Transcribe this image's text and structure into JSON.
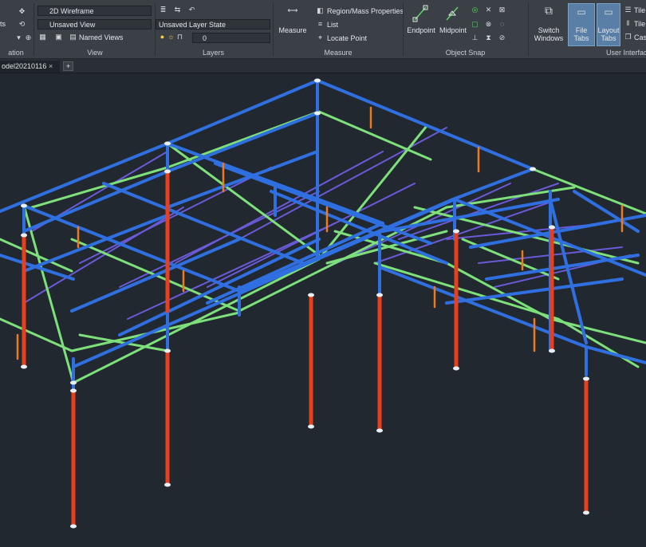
{
  "ribbon": {
    "panels": {
      "navigation_label": "ation",
      "view_label": "View",
      "layers_label": "Layers",
      "measure_label": "Measure",
      "object_snap_label": "Object Snap",
      "user_interface_label": "User Interfac"
    },
    "left_fragment": {
      "ts": "ts"
    },
    "view": {
      "visual_style": "2D Wireframe",
      "saved_view": "Unsaved View",
      "named_views": "Named Views"
    },
    "layers": {
      "layer_state": "Unsaved Layer State",
      "current_layer": "0"
    },
    "measure": {
      "measure_button": "Measure",
      "region_mass": "Region/Mass Properties",
      "list": "List",
      "locate_point": "Locate Point"
    },
    "object_snap": {
      "endpoint": "Endpoint",
      "midpoint": "Midpoint"
    },
    "user_interface": {
      "switch_windows_line1": "Switch",
      "switch_windows_line2": "Windows",
      "file_tabs_line1": "File Tabs",
      "layout_tabs_line1": "Layout",
      "layout_tabs_line2": "Tabs",
      "tile_h": "Tile",
      "tile_v": "Tile",
      "cascade": "Cas"
    }
  },
  "file_tabs": {
    "active_tab": "odel20210116",
    "close_glyph": "×",
    "add_glyph": "+"
  },
  "colors": {
    "blue_member": "#2f6fe0",
    "green_member": "#7de07a",
    "red_column": "#e8401c",
    "orange_strut": "#f07a1a",
    "purple_brace": "#6a5ad8",
    "viewport_bg": "#212830"
  },
  "icons": {
    "pan": "hand-icon",
    "orbit": "orbit-icon",
    "layer_properties": "layer-properties-icon",
    "bulb": "lightbulb-icon",
    "sun": "sun-icon",
    "lock": "lock-icon",
    "measure": "measure-icon",
    "endpoint": "endpoint-snap-icon",
    "midpoint": "midpoint-snap-icon"
  }
}
